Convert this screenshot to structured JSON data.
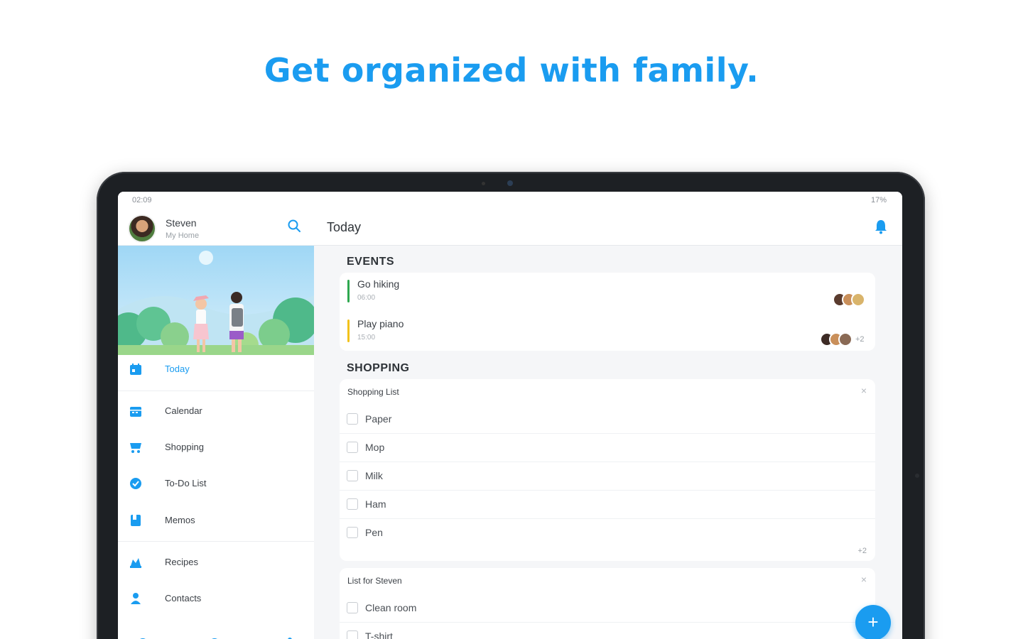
{
  "headline": "Get organized with family.",
  "status": {
    "time": "02:09",
    "right": "17%"
  },
  "profile": {
    "name": "Steven",
    "home": "My Home"
  },
  "sidebar": {
    "items": [
      {
        "label": "Today",
        "icon": "calendar-today-icon",
        "active": true
      },
      {
        "label": "Calendar",
        "icon": "calendar-icon"
      },
      {
        "label": "Shopping",
        "icon": "cart-icon"
      },
      {
        "label": "To-Do List",
        "icon": "check-circle-icon"
      },
      {
        "label": "Memos",
        "icon": "memo-icon"
      },
      {
        "label": "Recipes",
        "icon": "chef-hat-icon"
      },
      {
        "label": "Contacts",
        "icon": "contacts-icon"
      }
    ],
    "bottom_icons": [
      "settings-icon",
      "help-icon",
      "share-icon"
    ]
  },
  "topbar": {
    "title": "Today"
  },
  "events": {
    "title": "EVENTS",
    "items": [
      {
        "title": "Go hiking",
        "time": "06:00",
        "color": "#2fa84f"
      },
      {
        "title": "Play piano",
        "time": "15:00",
        "color": "#f2c21b",
        "more": "+2"
      }
    ]
  },
  "shopping": {
    "title": "SHOPPING",
    "lists": [
      {
        "name": "Shopping List",
        "close": "×",
        "items": [
          "Paper",
          "Mop",
          "Milk",
          "Ham",
          "Pen"
        ],
        "more": "+2"
      },
      {
        "name": "List for Steven",
        "close": "×",
        "items": [
          "Clean room",
          "T-shirt"
        ]
      }
    ]
  },
  "fab": {
    "label": "+"
  },
  "colors": {
    "accent": "#1a9cf0",
    "tablet_frame": "#1d2024",
    "screen_bg": "#f5f6f8"
  }
}
